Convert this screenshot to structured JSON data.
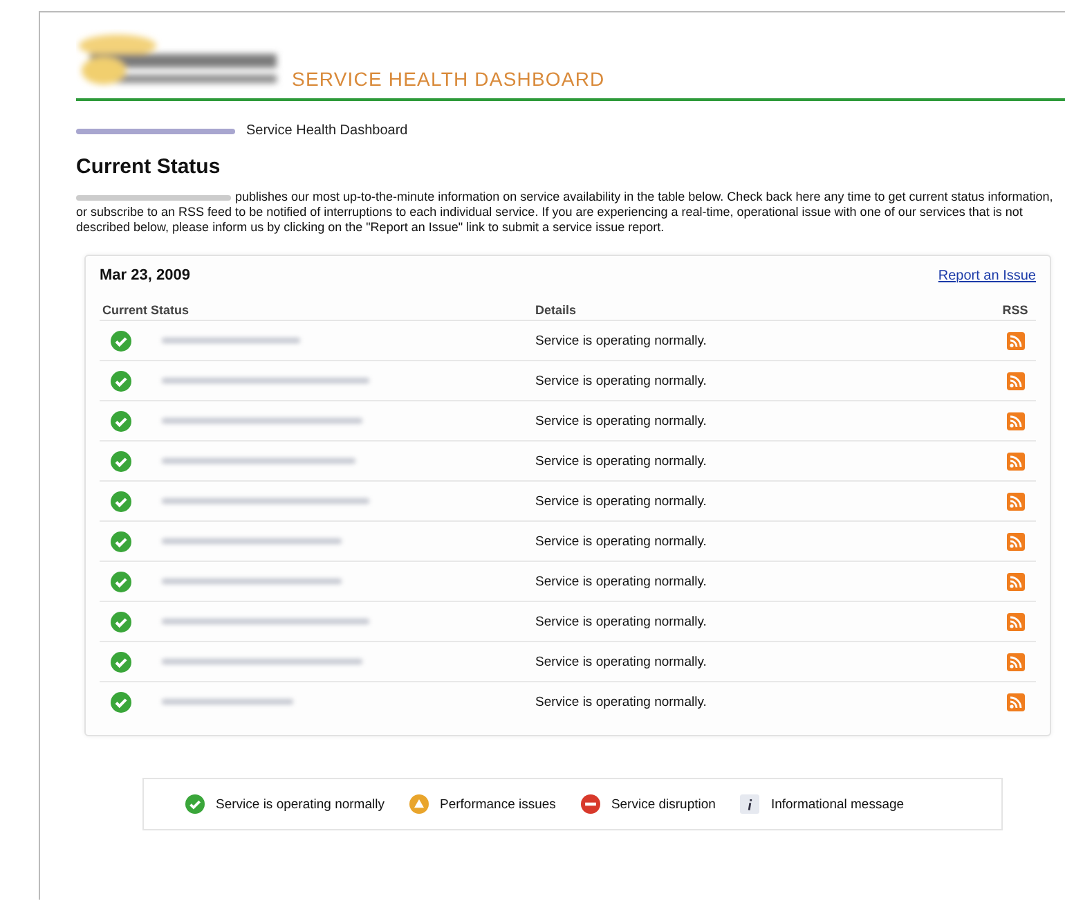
{
  "header": {
    "title": "SERVICE HEALTH DASHBOARD"
  },
  "breadcrumb": {
    "current": "Service Health Dashboard"
  },
  "heading": "Current Status",
  "intro": "publishes our most up-to-the-minute information on service availability in the table below. Check back here any time to get current status information, or subscribe to an RSS feed to be notified of interruptions to each individual service. If you are experiencing a real-time, operational issue with one of our services that is not described below, please inform us by clicking on the \"Report an Issue\" link to submit a service issue report.",
  "status_panel": {
    "date": "Mar 23, 2009",
    "report_link": "Report an Issue",
    "columns": [
      "Current Status",
      "Details",
      "RSS"
    ],
    "rows": [
      {
        "kind": "ok",
        "details": "Service is operating normally."
      },
      {
        "kind": "ok",
        "details": "Service is operating normally."
      },
      {
        "kind": "ok",
        "details": "Service is operating normally."
      },
      {
        "kind": "ok",
        "details": "Service is operating normally."
      },
      {
        "kind": "ok",
        "details": "Service is operating normally."
      },
      {
        "kind": "ok",
        "details": "Service is operating normally."
      },
      {
        "kind": "ok",
        "details": "Service is operating normally."
      },
      {
        "kind": "ok",
        "details": "Service is operating normally."
      },
      {
        "kind": "ok",
        "details": "Service is operating normally."
      },
      {
        "kind": "ok",
        "details": "Service is operating normally."
      }
    ]
  },
  "legend": [
    {
      "kind": "ok",
      "label": "Service is operating normally"
    },
    {
      "kind": "warn",
      "label": "Performance issues"
    },
    {
      "kind": "error",
      "label": "Service disruption"
    },
    {
      "kind": "info",
      "label": "Informational message"
    }
  ]
}
